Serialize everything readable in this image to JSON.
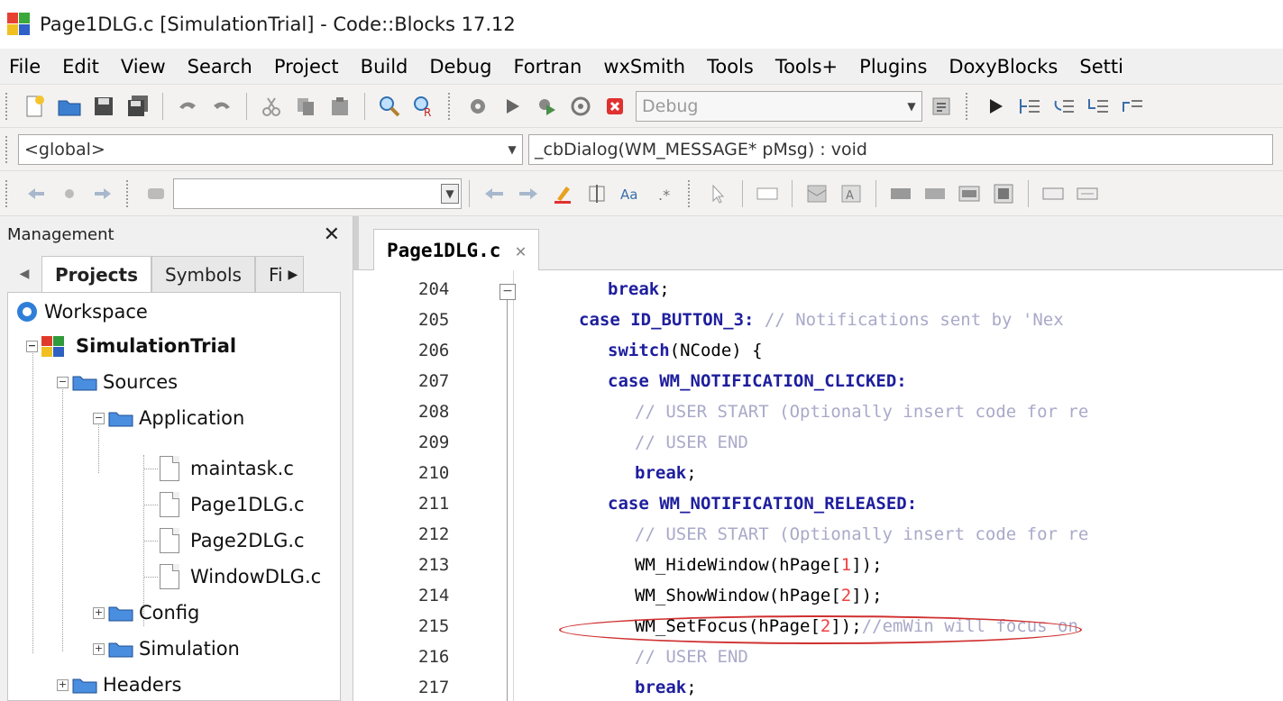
{
  "window": {
    "title": "Page1DLG.c [SimulationTrial] - Code::Blocks 17.12"
  },
  "menu": [
    "File",
    "Edit",
    "View",
    "Search",
    "Project",
    "Build",
    "Debug",
    "Fortran",
    "wxSmith",
    "Tools",
    "Tools+",
    "Plugins",
    "DoxyBlocks",
    "Setti"
  ],
  "toolbar": {
    "build_target": "Debug",
    "scope": "<global>",
    "function": "_cbDialog(WM_MESSAGE* pMsg) : void",
    "search_value": ""
  },
  "management": {
    "title": "Management",
    "tabs": [
      "Projects",
      "Symbols",
      "Fi"
    ],
    "tree": {
      "workspace": "Workspace",
      "project": "SimulationTrial",
      "sources": "Sources",
      "application": "Application",
      "files": [
        "maintask.c",
        "Page1DLG.c",
        "Page2DLG.c",
        "WindowDLG.c"
      ],
      "config": "Config",
      "simulation": "Simulation",
      "headers": "Headers"
    }
  },
  "editor": {
    "tab": "Page1DLG.c",
    "line_numbers": [
      "204",
      "205",
      "206",
      "207",
      "208",
      "209",
      "210",
      "211",
      "212",
      "213",
      "214",
      "215",
      "216",
      "217"
    ],
    "lines": [
      {
        "indent": "   ",
        "kw": "break",
        "rest": ";"
      },
      {
        "indent": "",
        "kw": "case",
        "rest": " ID_BUTTON_3: ",
        "comment": "// Notifications sent by 'Nex"
      },
      {
        "indent": "   ",
        "kw": "switch",
        "rest": "(NCode) {"
      },
      {
        "indent": "   ",
        "kw": "case",
        "rest": " WM_NOTIFICATION_CLICKED:"
      },
      {
        "indent": "     ",
        "comment": "// USER START (Optionally insert code for re"
      },
      {
        "indent": "     ",
        "comment": "// USER END"
      },
      {
        "indent": "     ",
        "kw": "break",
        "rest": ";"
      },
      {
        "indent": "   ",
        "kw": "case",
        "rest": " WM_NOTIFICATION_RELEASED:"
      },
      {
        "indent": "     ",
        "comment": "// USER START (Optionally insert code for re"
      },
      {
        "indent": "     ",
        "call": "WM_HideWindow(hPage[",
        "idx": "1",
        "tail": "]);"
      },
      {
        "indent": "     ",
        "call": "WM_ShowWindow(hPage[",
        "idx": "2",
        "tail": "]);"
      },
      {
        "indent": "     ",
        "call": "WM_SetFocus(hPage[",
        "idx": "2",
        "tail": "]);",
        "comment": "//emWin will focus on"
      },
      {
        "indent": "     ",
        "comment": "// USER END"
      },
      {
        "indent": "     ",
        "kw": "break",
        "rest": ";"
      }
    ]
  }
}
